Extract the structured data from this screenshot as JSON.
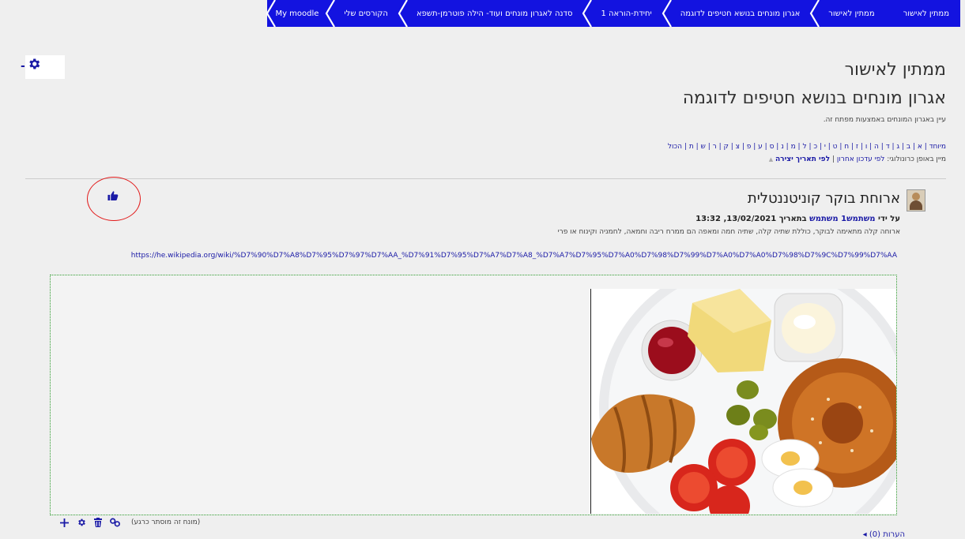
{
  "breadcrumbs": [
    {
      "label": "My moodle"
    },
    {
      "label": "הקורסים שלי"
    },
    {
      "label": "סדנה לאגרון מונחים ועוד- הילה פוטרמן-תשפא"
    },
    {
      "label": "יחידת-הוראה 1"
    },
    {
      "label": "אגרון מונחים בנושא חטיפים לדוגמה"
    },
    {
      "label": "ממתין לאישור"
    },
    {
      "label": "ממתין לאישור"
    }
  ],
  "page": {
    "heading": "ממתין לאישור",
    "glossary_title": "אגרון מונחים בנושא חטיפים לדוגמה",
    "intro": "עיין באגרון המונחים באמצעות מפתח זה.",
    "alphabet": [
      "מיוחד",
      "א",
      "ב",
      "ג",
      "ד",
      "ה",
      "ו",
      "ז",
      "ח",
      "ט",
      "י",
      "כ",
      "ל",
      "מ",
      "נ",
      "ס",
      "ע",
      "פ",
      "צ",
      "ק",
      "ר",
      "ש",
      "ת",
      "הכול"
    ],
    "sort_label": "מיין באופן כרונולוגי:",
    "sort_by_update": "לפי עדכון אחרון",
    "sort_by_created": "לפי תאריך יצירה",
    "sort_arrow": "▲"
  },
  "entry": {
    "title": "ארוחת בוקר קוניטננטלית",
    "author_prefix": "על ידי",
    "author_name": "משתמש1 משתמש",
    "date_prefix": "בתאריך",
    "date": "13/02/2021, 13:32",
    "definition": "ארוחה קלה מתאימה לבוקר, כוללת שתיה קלה, שתיה חמה ומאפה הם ממרח ריבה וחמאה, לחמניה וקינוח או פרי",
    "url": "https://he.wikipedia.org/wiki/%D7%90%D7%A8%D7%95%D7%97%D7%AA_%D7%91%D7%95%D7%A7%D7%A8_%D7%A7%D7%95%D7%A0%D7%98%D7%99%D7%A0%D7%A0%D7%98%D7%9C%D7%99%D7%AA",
    "hidden_note": "(מונח זה מוסתר כרגע)",
    "comments": "הערות (0)"
  },
  "icons": [
    "gear-icon",
    "like-icon",
    "add-icon",
    "settings-icon",
    "delete-icon",
    "link-icon"
  ],
  "colors": {
    "nav_bar": "#1313e0",
    "link": "#1a1aa6",
    "annotation_circle": "#e21b1b",
    "image_frame": "#2e9b2e"
  }
}
